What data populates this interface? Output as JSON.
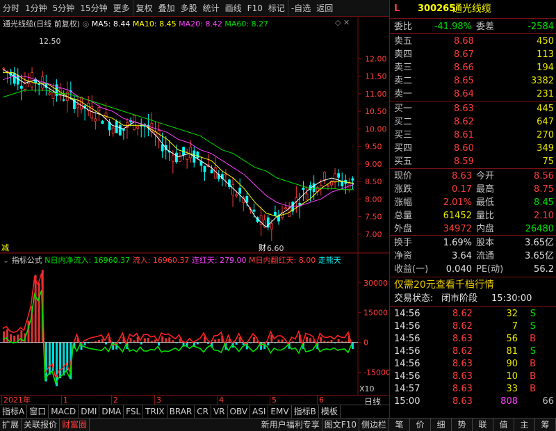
{
  "toolbar": {
    "items": [
      "分时",
      "1分钟",
      "5分钟",
      "15分钟",
      "更多",
      "复权",
      "叠加",
      "多股",
      "统计",
      "画线",
      "F10",
      "标记",
      "-自选",
      "返回"
    ]
  },
  "main_legend": {
    "title": "通光线缆(日线 前复权)",
    "ma5": "MA5: 8.44",
    "ma10": "MA10: 8.45",
    "ma20": "MA20: 8.42",
    "ma60": "MA60: 8.27",
    "high_label": "12.50",
    "low_label": "6.60",
    "reduce_tag": "减",
    "cai_tag": "财"
  },
  "sub_legend": {
    "name": "指标公式",
    "n_flow": "N日内净流入: 16960.37",
    "inflow": "流入: 16960.37",
    "streak": "连红天: 279.00",
    "flip": "M日内翻红天: 8.00",
    "tail": "走",
    "tail2": "熊天"
  },
  "colors": {
    "up": "#ff3c3c",
    "down": "#00ffff",
    "ma5": "#ffffff",
    "ma10": "#ffff00",
    "ma20": "#ff40ff",
    "ma60": "#00e000"
  },
  "chart_data": [
    {
      "type": "candlestick",
      "yaxis_ticks": [
        "12.00",
        "11.50",
        "11.00",
        "10.50",
        "10.00",
        "9.50",
        "9.00",
        "8.50",
        "8.00",
        "7.50",
        "7.00"
      ],
      "ylim": [
        6.5,
        12.8
      ],
      "x_ticks": [
        "2021年",
        "1",
        "2",
        "3",
        "4",
        "5",
        "6"
      ],
      "series": [
        {
          "name": "MA5",
          "values": [
            11.7,
            11.5,
            11.3,
            11.4,
            11.2,
            11.0,
            10.9,
            10.7,
            10.5,
            10.4,
            10.1,
            10.0,
            10.2,
            10.1,
            9.8,
            9.4,
            9.2,
            9.3,
            9.1,
            8.9,
            8.6,
            8.3,
            8.0,
            7.5,
            7.2,
            7.5,
            7.7,
            8.0,
            8.3,
            8.5,
            8.6,
            8.5,
            8.44
          ]
        },
        {
          "name": "MA10",
          "values": [
            11.6,
            11.6,
            11.4,
            11.3,
            11.3,
            11.1,
            10.9,
            10.8,
            10.6,
            10.4,
            10.3,
            10.1,
            10.1,
            10.1,
            9.9,
            9.7,
            9.4,
            9.3,
            9.2,
            9.1,
            8.8,
            8.6,
            8.3,
            7.9,
            7.6,
            7.5,
            7.6,
            7.8,
            8.0,
            8.3,
            8.5,
            8.5,
            8.45
          ]
        },
        {
          "name": "MA20",
          "values": [
            11.4,
            11.5,
            11.5,
            11.4,
            11.3,
            11.2,
            11.1,
            10.9,
            10.8,
            10.6,
            10.5,
            10.3,
            10.2,
            10.1,
            10.0,
            9.9,
            9.7,
            9.6,
            9.4,
            9.3,
            9.1,
            8.9,
            8.7,
            8.4,
            8.1,
            7.9,
            7.8,
            7.8,
            7.9,
            8.0,
            8.2,
            8.3,
            8.42
          ]
        },
        {
          "name": "MA60",
          "values": [
            10.9,
            11.0,
            11.1,
            11.1,
            11.1,
            11.0,
            11.0,
            10.9,
            10.8,
            10.7,
            10.6,
            10.5,
            10.4,
            10.3,
            10.2,
            10.1,
            10.0,
            9.9,
            9.8,
            9.6,
            9.4,
            9.3,
            9.1,
            8.9,
            8.8,
            8.6,
            8.5,
            8.4,
            8.3,
            8.3,
            8.3,
            8.27,
            8.27
          ]
        }
      ]
    },
    {
      "type": "bar",
      "yaxis_ticks": [
        "30000",
        "15000",
        "0",
        "-15000"
      ],
      "ylim": [
        -25000,
        38000
      ],
      "scale_label": "X10"
    }
  ],
  "period": "日线",
  "bottom_tabs1": [
    "指标A",
    "窗口",
    "MACD",
    "DMI",
    "DMA",
    "FSL",
    "TRIX",
    "BRAR",
    "CR",
    "VR",
    "OBV",
    "ASI",
    "EMV",
    "指标B",
    "模板"
  ],
  "bottom_tabs2": [
    "扩展",
    "关联报价",
    "财富圈",
    "新用户福利专享",
    "图文F10",
    "侧边栏"
  ],
  "panel": {
    "flag": "L",
    "code": "300265",
    "name": "通光线缆",
    "weibi_label": "委比",
    "weibi": "-41.98%",
    "weicha_label": "委差",
    "weicha": "-2584",
    "asks": [
      {
        "label": "卖五",
        "price": "8.68",
        "vol": "450"
      },
      {
        "label": "卖四",
        "price": "8.67",
        "vol": "113"
      },
      {
        "label": "卖三",
        "price": "8.66",
        "vol": "194"
      },
      {
        "label": "卖二",
        "price": "8.65",
        "vol": "3382"
      },
      {
        "label": "卖一",
        "price": "8.64",
        "vol": "231"
      }
    ],
    "bids": [
      {
        "label": "买一",
        "price": "8.63",
        "vol": "445"
      },
      {
        "label": "买二",
        "price": "8.62",
        "vol": "647"
      },
      {
        "label": "买三",
        "price": "8.61",
        "vol": "270"
      },
      {
        "label": "买四",
        "price": "8.60",
        "vol": "349"
      },
      {
        "label": "买五",
        "price": "8.59",
        "vol": "75"
      }
    ],
    "quote": [
      {
        "l1": "现价",
        "v1": "8.63",
        "l2": "今开",
        "v2": "8.56"
      },
      {
        "l1": "涨跌",
        "v1": "0.17",
        "l2": "最高",
        "v2": "8.75"
      },
      {
        "l1": "涨幅",
        "v1": "2.01%",
        "l2": "最低",
        "v2": "8.45"
      },
      {
        "l1": "总量",
        "v1": "61452",
        "l2": "量比",
        "v2": "2.10"
      },
      {
        "l1": "外盘",
        "v1": "34972",
        "l2": "内盘",
        "v2": "26480"
      }
    ],
    "fin": [
      {
        "l1": "换手",
        "v1": "1.69%",
        "l2": "股本",
        "v2": "3.65亿"
      },
      {
        "l1": "净资",
        "v1": "3.64",
        "l2": "流通",
        "v2": "3.65亿"
      },
      {
        "l1": "收益(一)",
        "v1": "0.040",
        "l2": "PE(动)",
        "v2": "56.2"
      }
    ],
    "promo": "仅需20元查看千档行情",
    "status_label": "交易状态:",
    "status": "闭市阶段",
    "status_time": "15:30:00",
    "ticks": [
      {
        "time": "14:56",
        "price": "8.62",
        "vol": "32",
        "side": "S"
      },
      {
        "time": "14:56",
        "price": "8.62",
        "vol": "7",
        "side": "S"
      },
      {
        "time": "14:56",
        "price": "8.63",
        "vol": "56",
        "side": "B"
      },
      {
        "time": "14:56",
        "price": "8.62",
        "vol": "81",
        "side": "S"
      },
      {
        "time": "14:56",
        "price": "8.63",
        "vol": "90",
        "side": "B"
      },
      {
        "time": "14:56",
        "price": "8.63",
        "vol": "10",
        "side": "B"
      },
      {
        "time": "14:57",
        "price": "8.63",
        "vol": "33",
        "side": "B"
      },
      {
        "time": "15:00",
        "price": "8.63",
        "vol": "808",
        "side": "66"
      }
    ],
    "tabs": [
      "笔",
      "价",
      "细",
      "势",
      "联",
      "值",
      "主",
      "筹"
    ]
  }
}
